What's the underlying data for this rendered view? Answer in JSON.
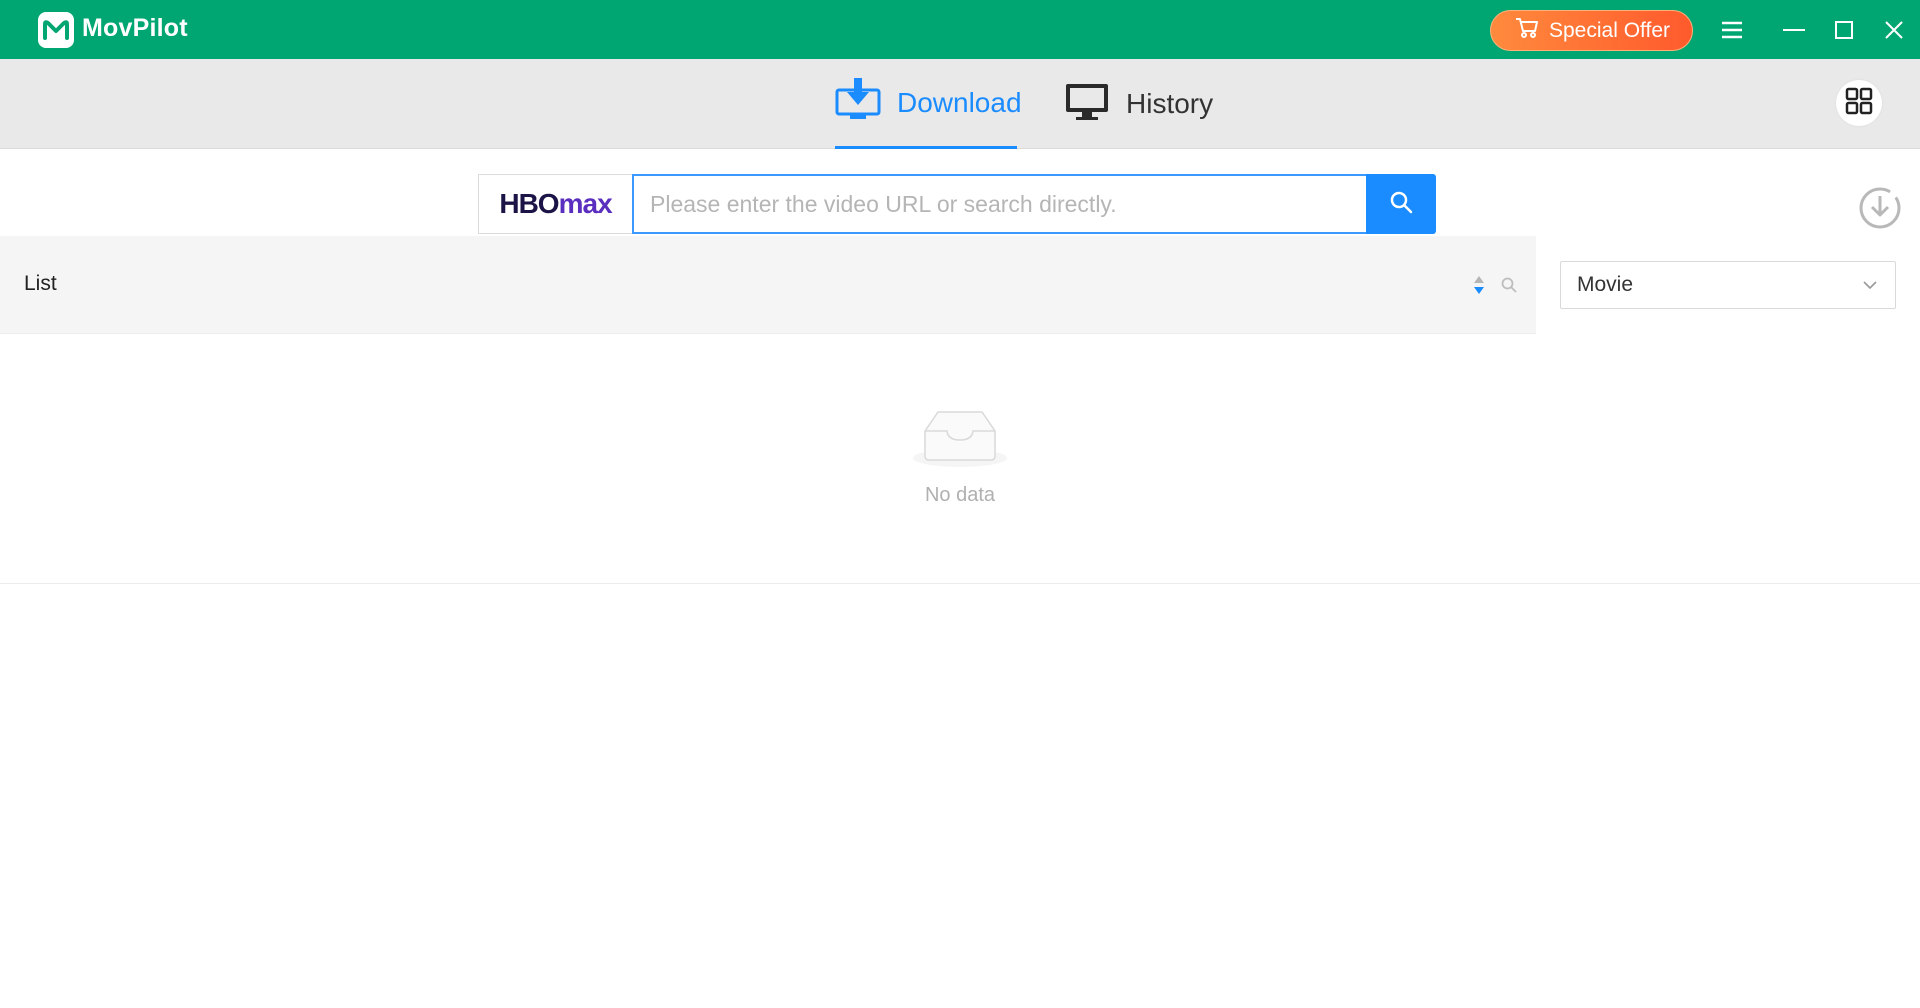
{
  "app": {
    "name": "MovPilot"
  },
  "titlebar": {
    "offer_label": "Special Offer",
    "icons": [
      "menu-icon",
      "minimize-icon",
      "maximize-icon",
      "close-icon"
    ]
  },
  "nav": {
    "tabs": [
      {
        "label": "Download",
        "icon": "download-tray-icon",
        "active": true
      },
      {
        "label": "History",
        "icon": "monitor-icon",
        "active": false
      }
    ],
    "grid_icon": "grid-icon"
  },
  "search": {
    "service_logo": {
      "part1": "HBO",
      "part2": "max"
    },
    "placeholder": "Please enter the video URL or search directly.",
    "value": ""
  },
  "list": {
    "title": "List",
    "type_select": {
      "selected": "Movie"
    },
    "empty_text": "No data"
  },
  "colors": {
    "titlebar": "#00a671",
    "accent": "#1a8cff",
    "offer": "#ff6a33"
  }
}
